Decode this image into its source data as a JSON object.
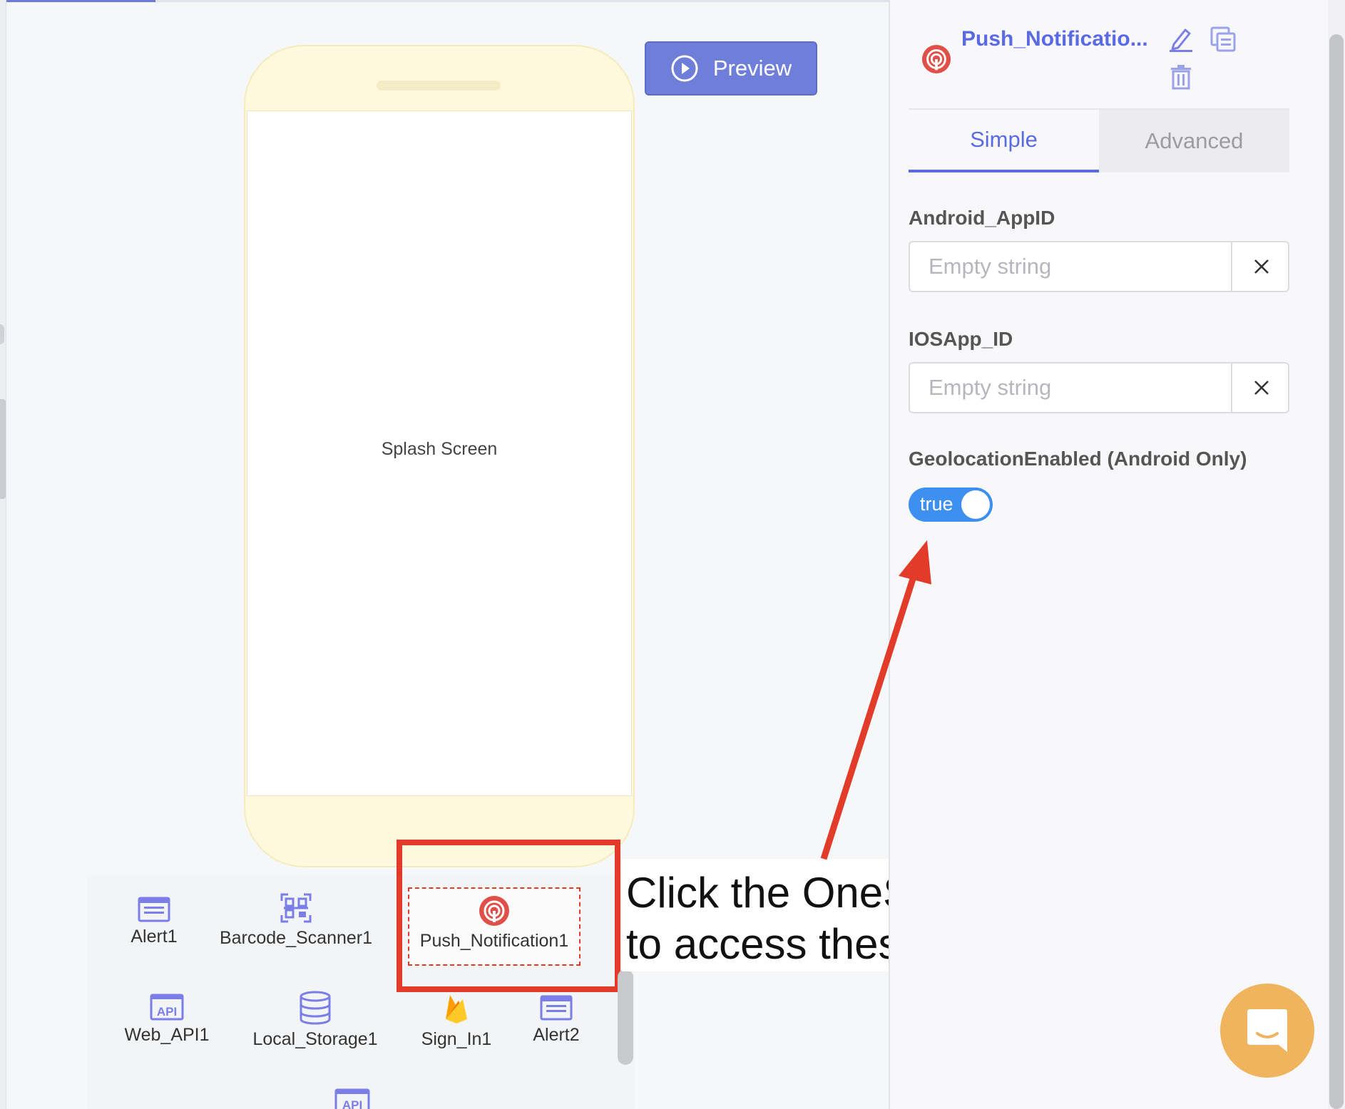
{
  "canvas": {
    "preview_label": "Preview",
    "screen_label": "Splash Screen"
  },
  "components": [
    {
      "label": "Alert1",
      "icon": "alert-icon"
    },
    {
      "label": "Barcode_Scanner1",
      "icon": "barcode-scanner-icon"
    },
    {
      "label": "Push_Notification1",
      "icon": "onesignal-icon"
    },
    {
      "label": "Web_API1",
      "icon": "api-icon"
    },
    {
      "label": "Local_Storage1",
      "icon": "database-icon"
    },
    {
      "label": "Sign_In1",
      "icon": "firebase-icon"
    },
    {
      "label": "Alert2",
      "icon": "alert-icon"
    }
  ],
  "callout": {
    "line1": "Click the OneSignal Icon",
    "line2": "to access these settings"
  },
  "panel": {
    "title": "Push_Notificatio...",
    "tabs": [
      {
        "label": "Simple",
        "active": true
      },
      {
        "label": "Advanced",
        "active": false
      }
    ],
    "fields": [
      {
        "label": "Android_AppID",
        "value": "",
        "placeholder": "Empty string"
      },
      {
        "label": "IOSApp_ID",
        "value": "",
        "placeholder": "Empty string"
      }
    ],
    "geolocation": {
      "label": "GeolocationEnabled (Android Only)",
      "toggle_text": "true",
      "enabled": true
    }
  },
  "colors": {
    "accent": "#5a6ae3",
    "preview_button": "#6f7fd9",
    "annotation_red": "#e23b2a",
    "toggle_on": "#3d8ff0",
    "chat_button": "#f0b35e",
    "onesignal_red": "#e0504a"
  }
}
